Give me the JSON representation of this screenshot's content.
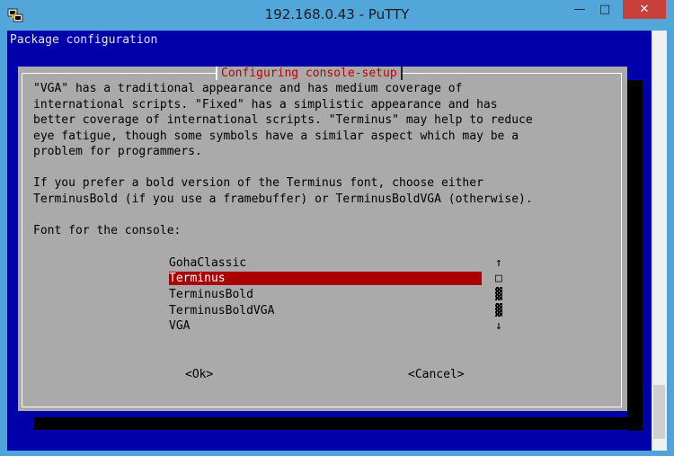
{
  "window": {
    "title": "192.168.0.43 - PuTTY",
    "app_icon": "putty-icon",
    "buttons": {
      "minimize": "—",
      "maximize": "□",
      "close": "✕"
    }
  },
  "terminal": {
    "header": "Package configuration",
    "dialog_title": "Configuring console-setup",
    "description": [
      "\"VGA\" has a traditional appearance and has medium coverage of",
      "international scripts. \"Fixed\" has a simplistic appearance and has",
      "better coverage of international scripts. \"Terminus\" may help to reduce",
      "eye fatigue, though some symbols have a similar aspect which may be a",
      "problem for programmers.",
      "",
      "If you prefer a bold version of the Terminus font, choose either",
      "TerminusBold (if you use a framebuffer) or TerminusBoldVGA (otherwise).",
      "",
      "Font for the console:"
    ],
    "options": [
      "GohaClassic",
      "Terminus",
      "TerminusBold",
      "TerminusBoldVGA",
      "VGA"
    ],
    "selected_index": 1,
    "scroll_indicators": [
      "↑",
      "□",
      "▓",
      "▓",
      "↓"
    ],
    "ok_label": "<Ok>",
    "cancel_label": "<Cancel>"
  },
  "colors": {
    "terminal_bg": "#0000aa",
    "dialog_bg": "#aaaaaa",
    "selection_bg": "#aa0000",
    "title_red": "#c00000"
  }
}
